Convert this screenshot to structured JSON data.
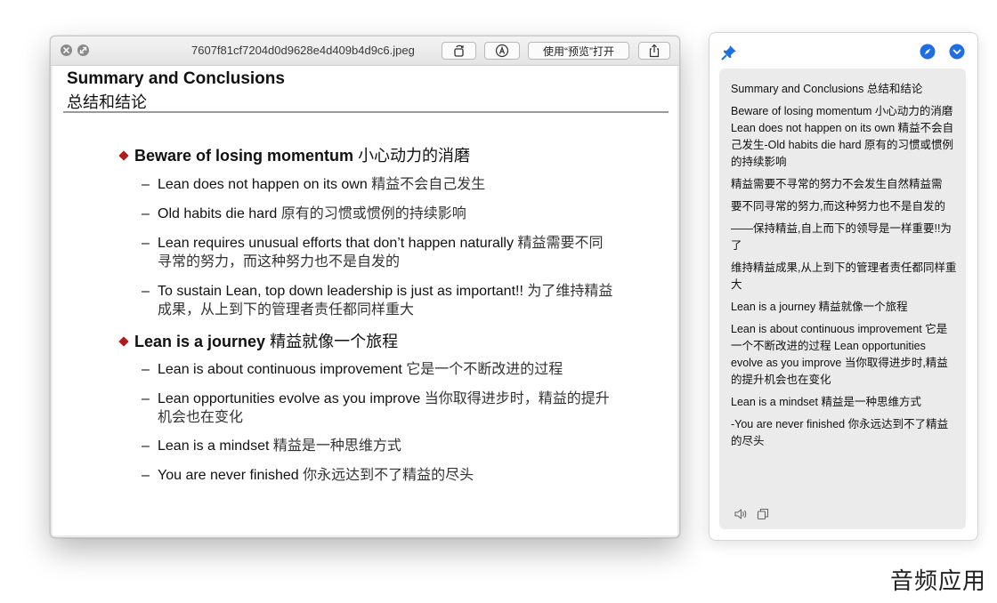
{
  "viewer": {
    "filename": "7607f81cf7204d0d9628e4d409b4d9c6.jpeg",
    "open_with_label": "使用“预览”打开",
    "close_icon": "close-icon",
    "fullscreen_icon": "fullscreen-icon",
    "rotate_icon": "rotate-icon",
    "markup_icon": "markup-icon",
    "share_icon": "share-icon"
  },
  "slide": {
    "title_en": "Summary and Conclusions",
    "title_zh": "总结和结论",
    "accent_color": "#b01c1c",
    "sections": [
      {
        "heading_en": "Beware of losing momentum",
        "heading_zh": "小心动力的消磨",
        "items": [
          {
            "en": "Lean does not happen on its own",
            "zh": "精益不会自己发生"
          },
          {
            "en": "Old habits die hard",
            "zh": "原有的习惯或惯例的持续影响"
          },
          {
            "en": "Lean requires unusual efforts that don’t happen naturally",
            "zh": "精益需要不同寻常的努力，而这种努力也不是自发的"
          },
          {
            "en": "To sustain Lean, top down leadership is just as important!!",
            "zh": "为了维持精益成果，从上到下的管理者责任都同样重大"
          }
        ]
      },
      {
        "heading_en": "Lean is a journey",
        "heading_zh": "精益就像一个旅程",
        "items": [
          {
            "en": "Lean is about continuous improvement",
            "zh": "它是一个不断改进的过程"
          },
          {
            "en": "Lean opportunities evolve as you improve",
            "zh": "当你取得进步时，精益的提升机会也在变化"
          },
          {
            "en": "Lean is a mindset",
            "zh": "精益是一种思维方式"
          },
          {
            "en": "You are never finished",
            "zh": "你永远达到不了精益的尽头"
          }
        ]
      }
    ]
  },
  "translation": {
    "pin_icon": "pin-icon",
    "compass_icon": "compass-icon",
    "chevron_icon": "chevron-down-icon",
    "accent_color": "#1f6fe0",
    "paragraphs": [
      "Summary and Conclusions 总结和结论",
      "Beware of losing momentum 小心动力的消磨 Lean does not happen on its own 精益不会自己发生-Old habits die hard 原有的习惯或惯例的持续影响",
      "精益需要不寻常的努力不会发生自然精益需",
      "要不同寻常的努力,而这种努力也不是自发的",
      "——保持精益,自上而下的领导是一样重要!!为了",
      "维持精益成果,从上到下的管理者责任都同样重大",
      "Lean is a journey 精益就像一个旅程",
      "Lean is about continuous improvement 它是一个不断改进的过程 Lean opportunities evolve as you improve 当你取得进步时,精益的提升机会也在变化",
      "Lean is a mindset 精益是一种思维方式",
      "-You are never finished 你永远达到不了精益的尽头"
    ],
    "speaker_icon": "speaker-icon",
    "copy_icon": "copy-icon"
  },
  "watermark": "音频应用"
}
